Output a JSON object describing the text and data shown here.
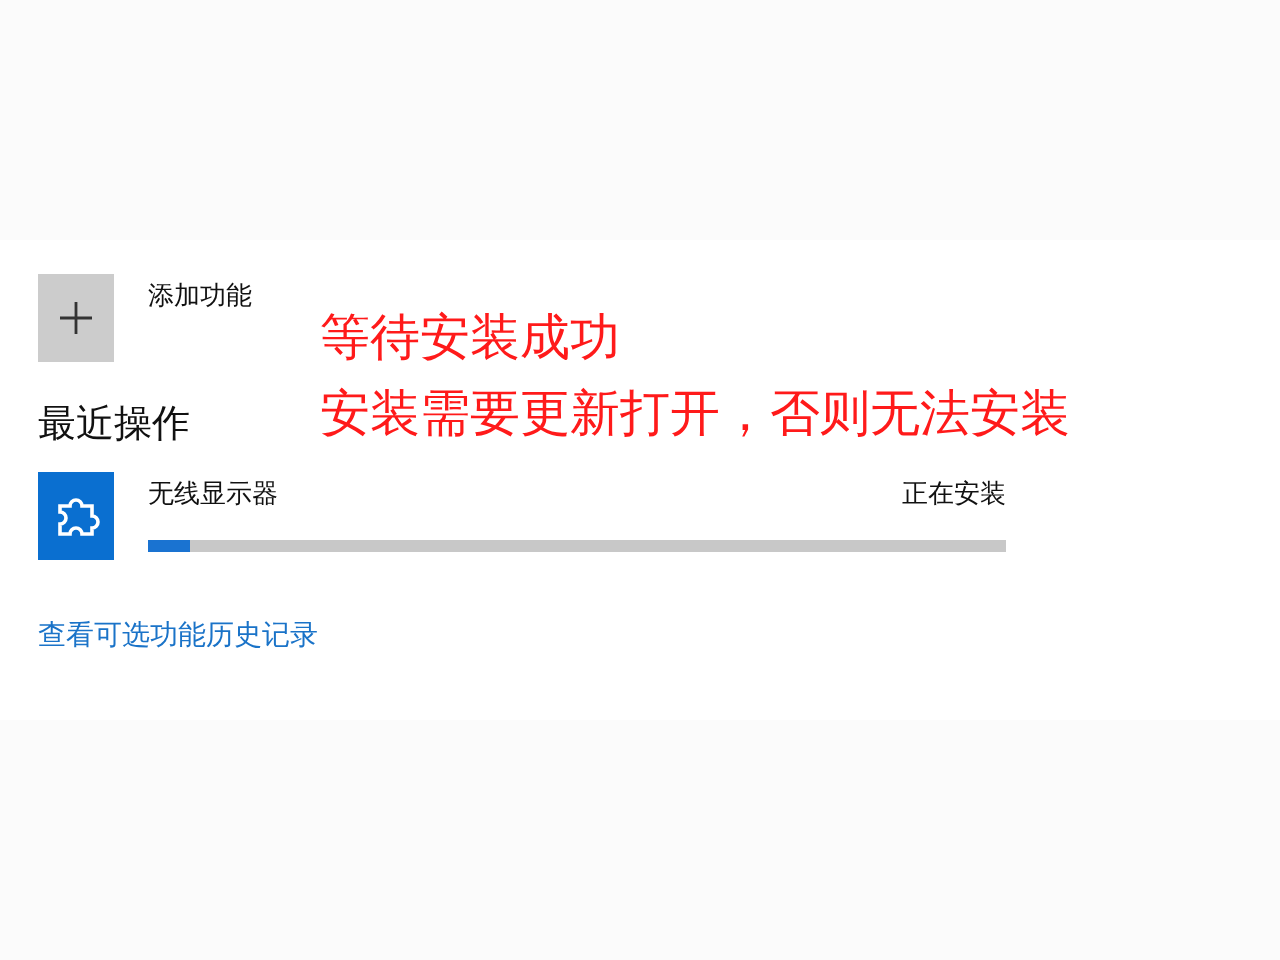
{
  "add_feature": {
    "label": "添加功能"
  },
  "recent_heading": "最近操作",
  "recent_items": [
    {
      "name": "无线显示器",
      "status": "正在安装",
      "level": 0.05
    }
  ],
  "history_link": "查看可选功能历史记录",
  "annotation": [
    "等待安装成功",
    "安装需要更新打开，否则无法安装"
  ]
}
